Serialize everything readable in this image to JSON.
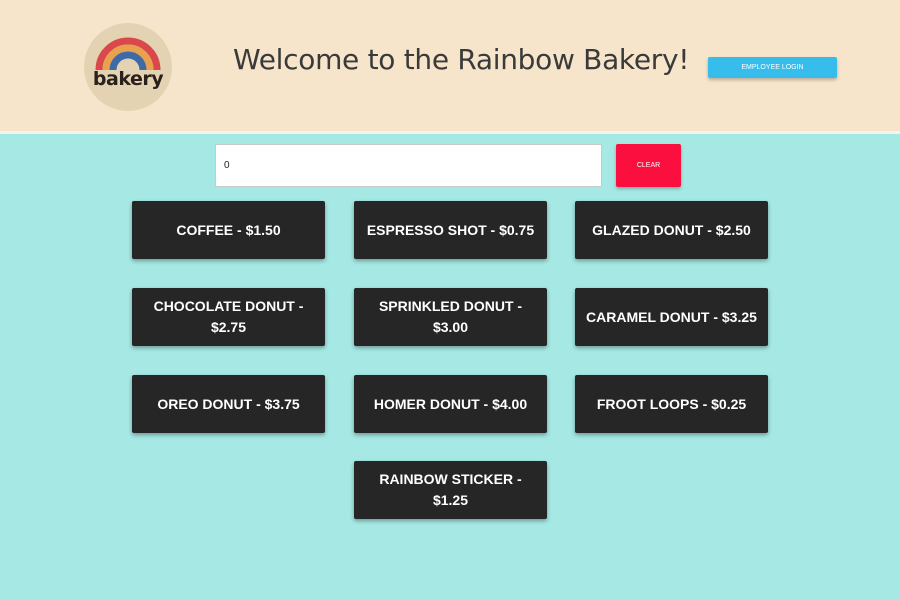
{
  "header": {
    "logo_text": "bakery",
    "title": "Welcome to the Rainbow Bakery!",
    "employee_login_label": "EMPLOYEE LOGIN"
  },
  "order": {
    "total_value": "0",
    "clear_label": "CLEAR"
  },
  "menu_items": [
    {
      "label": "COFFEE - $1.50"
    },
    {
      "label": "ESPRESSO SHOT - $0.75"
    },
    {
      "label": "GLAZED DONUT - $2.50"
    },
    {
      "label": "CHOCOLATE DONUT - $2.75"
    },
    {
      "label": "SPRINKLED DONUT - $3.00"
    },
    {
      "label": "CARAMEL DONUT - $3.25"
    },
    {
      "label": "OREO DONUT - $3.75"
    },
    {
      "label": "HOMER DONUT - $4.00"
    },
    {
      "label": "FROOT LOOPS - $0.25"
    },
    {
      "label": "RAINBOW STICKER - $1.25"
    }
  ],
  "colors": {
    "header_bg": "#f6e5cb",
    "page_bg": "#a6e9e4",
    "login_button": "#36bdec",
    "clear_button": "#fa0f3e",
    "item_button": "#262626",
    "rainbow_outer": "#d9484a",
    "rainbow_middle": "#e8a14c",
    "rainbow_inner": "#3e6aa8"
  },
  "icons": {
    "logo": "rainbow-logo-icon"
  }
}
